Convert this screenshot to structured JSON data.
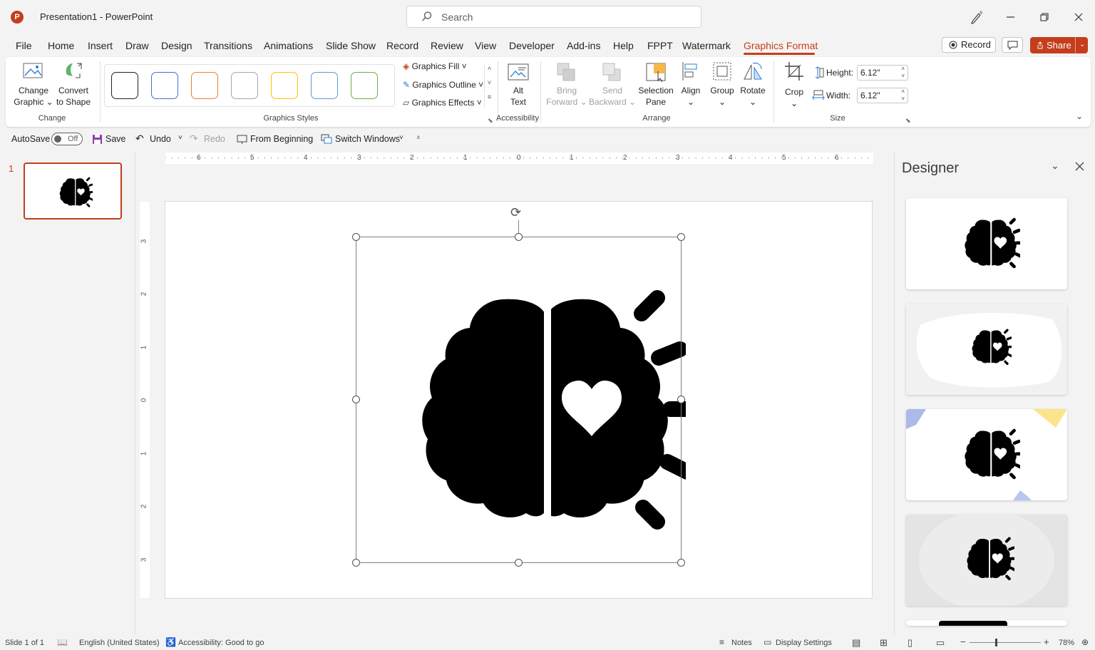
{
  "app": {
    "doc_title": "Presentation1  -  PowerPoint",
    "logo_letter": "P"
  },
  "search": {
    "placeholder": "Search"
  },
  "tabs": [
    "File",
    "Home",
    "Insert",
    "Draw",
    "Design",
    "Transitions",
    "Animations",
    "Slide Show",
    "Record",
    "Review",
    "View",
    "Developer",
    "Add-ins",
    "Help",
    "FPPT",
    "Watermark",
    "Graphics Format"
  ],
  "header": {
    "record_label": "Record",
    "share_label": "Share"
  },
  "ribbon": {
    "change_group": {
      "label": "Change",
      "change_graphic": [
        "Change",
        "Graphic"
      ],
      "convert": [
        "Convert",
        "to Shape"
      ]
    },
    "styles_group": {
      "label": "Graphics Styles",
      "swatch_colors": [
        "#222222",
        "#4472c4",
        "#ed7d31",
        "#a5a5a5",
        "#ffc000",
        "#5b9bd5",
        "#70ad47"
      ]
    },
    "fill_label": "Graphics Fill",
    "outline_label": "Graphics Outline",
    "effects_label": "Graphics Effects",
    "accessibility_group": {
      "label": "Accessibility",
      "alt_text": [
        "Alt",
        "Text"
      ]
    },
    "arrange_group": {
      "label": "Arrange",
      "bring_forward": [
        "Bring",
        "Forward"
      ],
      "send_backward": [
        "Send",
        "Backward"
      ],
      "selection_pane": [
        "Selection",
        "Pane"
      ],
      "align": "Align",
      "group": "Group",
      "rotate": "Rotate"
    },
    "size_group": {
      "label": "Size",
      "crop": "Crop",
      "height_label": "Height:",
      "height_value": "6.12\"",
      "width_label": "Width:",
      "width_value": "6.12\""
    }
  },
  "qat": {
    "autosave": "AutoSave",
    "toggle_state": "Off",
    "save": "Save",
    "undo": "Undo",
    "redo": "Redo",
    "from_beginning": "From Beginning",
    "switch_windows": "Switch Windows"
  },
  "thumbnails": {
    "slide_number": "1"
  },
  "ruler": {
    "h_ticks": [
      "6",
      "5",
      "4",
      "3",
      "2",
      "1",
      "0",
      "1",
      "2",
      "3",
      "4",
      "5",
      "6"
    ],
    "v_ticks": [
      "3",
      "2",
      "1",
      "0",
      "1",
      "2",
      "3"
    ]
  },
  "designer": {
    "title": "Designer"
  },
  "status": {
    "slide": "Slide 1 of 1",
    "language": "English (United States)",
    "accessibility": "Accessibility: Good to go",
    "notes": "Notes",
    "display_settings": "Display Settings",
    "zoom": "78%"
  },
  "colors": {
    "accent": "#c43e1c"
  }
}
